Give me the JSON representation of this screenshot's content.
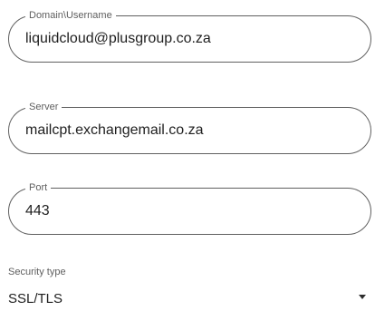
{
  "fields": [
    {
      "label": "Domain\\Username",
      "value": "liquidcloud@plusgroup.co.za"
    },
    {
      "label": "Server",
      "value": "mailcpt.exchangemail.co.za"
    },
    {
      "label": "Port",
      "value": "443"
    }
  ],
  "security": {
    "label": "Security type",
    "value": "SSL/TLS"
  },
  "icons": {
    "dropdown": "chevron-down-icon"
  },
  "colors": {
    "border": "#606060",
    "label": "#5f5f5f",
    "text": "#1f1f1f"
  }
}
